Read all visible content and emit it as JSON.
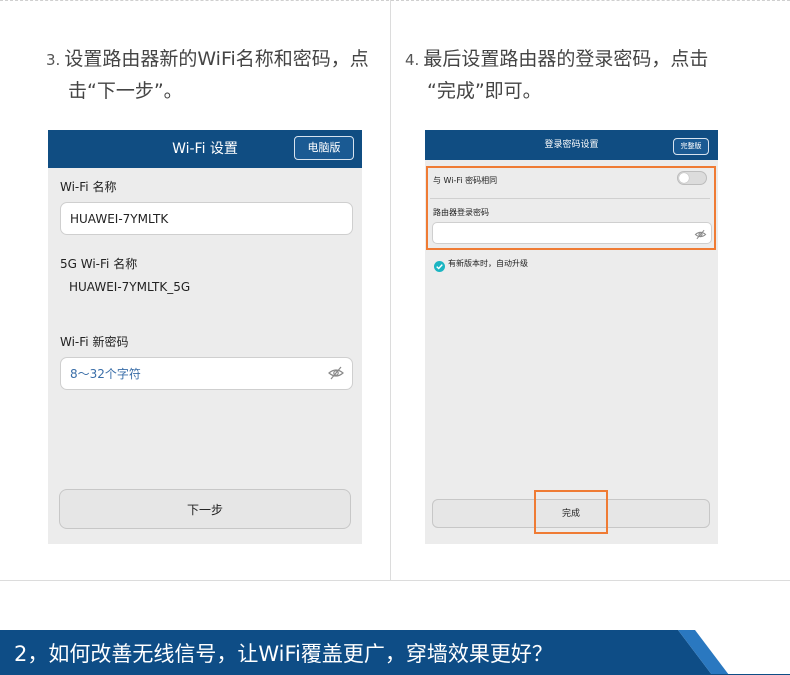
{
  "colors": {
    "header_blue": "#104d82",
    "banner_blue": "#0e4d86",
    "highlight_orange": "#ef7b34",
    "check_teal": "#1bb5c2"
  },
  "step3": {
    "number": "3.",
    "line1": "设置路由器新的WiFi名称和密码，点",
    "line2": "击“下一步”。",
    "screen": {
      "title": "Wi-Fi 设置",
      "top_button": "电脑版",
      "wifi_name_label": "Wi-Fi 名称",
      "wifi_name_value": "HUAWEI-7YMLTK",
      "wifi5g_label": "5G Wi-Fi 名称",
      "wifi5g_value": "HUAWEI-7YMLTK_5G",
      "password_label": "Wi-Fi 新密码",
      "password_placeholder": "8～32个字符",
      "next_button": "下一步",
      "icons": {
        "password_toggle": "eye-hidden-icon"
      }
    }
  },
  "step4": {
    "number": "4.",
    "line1": "最后设置路由器的登录密码，点击",
    "line2": "“完成”即可。",
    "screen": {
      "title": "登录密码设置",
      "top_button": "完整版",
      "same_as_wifi_label": "与 Wi-Fi 密码相同",
      "same_as_wifi_on": false,
      "router_password_label": "路由器登录密码",
      "auto_upgrade_label": "有新版本时，自动升级",
      "auto_upgrade_checked": true,
      "done_button": "完成",
      "icons": {
        "password_toggle": "eye-hidden-icon",
        "check": "check-circle-icon",
        "toggle": "toggle-switch-icon"
      }
    }
  },
  "banner": {
    "text": "2，如何改善无线信号，让WiFi覆盖更广，穿墙效果更好？"
  }
}
